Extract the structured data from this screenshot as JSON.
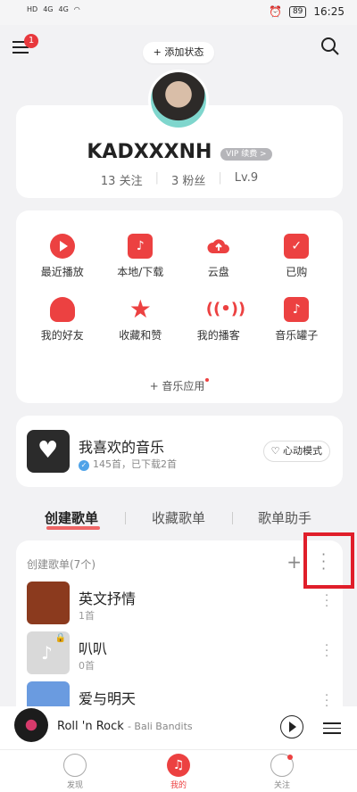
{
  "status_bar": {
    "left": [
      "HD",
      "4G",
      "4G"
    ],
    "battery": "89",
    "time": "16:25"
  },
  "top_bar": {
    "menu_badge": "1",
    "add_status": "+ 添加状态"
  },
  "profile": {
    "username": "KADXXXNH",
    "vip_label": "VIP 续费 >",
    "following": "13 关注",
    "followers": "3 粉丝",
    "level": "Lv.9"
  },
  "grid": [
    {
      "label": "最近播放",
      "icon": "play-icon"
    },
    {
      "label": "本地/下载",
      "icon": "music-note-icon"
    },
    {
      "label": "云盘",
      "icon": "cloud-upload-icon"
    },
    {
      "label": "已购",
      "icon": "bag-icon"
    },
    {
      "label": "我的好友",
      "icon": "friends-icon"
    },
    {
      "label": "收藏和赞",
      "icon": "star-icon"
    },
    {
      "label": "我的播客",
      "icon": "broadcast-icon"
    },
    {
      "label": "音乐罐子",
      "icon": "music-jar-icon"
    }
  ],
  "music_apps": "+ 音乐应用",
  "liked": {
    "title": "我喜欢的音乐",
    "subtitle": "145首，已下载2首",
    "mode_button": "心动模式"
  },
  "tabs": [
    "创建歌单",
    "收藏歌单",
    "歌单助手"
  ],
  "playlists": {
    "header": "创建歌单(7个)",
    "items": [
      {
        "name": "英文抒情",
        "count": "1首",
        "color": "#8b3a1e"
      },
      {
        "name": "叭叭",
        "count": "0首",
        "color": "#d9d9d9"
      },
      {
        "name": "爱与明天",
        "count": "",
        "color": "#6a9be0"
      }
    ]
  },
  "mini_player": {
    "title": "Roll 'n Rock",
    "artist": "- Bali Bandits"
  },
  "bottom_nav": [
    {
      "label": "发现"
    },
    {
      "label": "我的"
    },
    {
      "label": "关注"
    }
  ],
  "colors": {
    "accent": "#ec4141",
    "highlight": "#e01e2a"
  }
}
